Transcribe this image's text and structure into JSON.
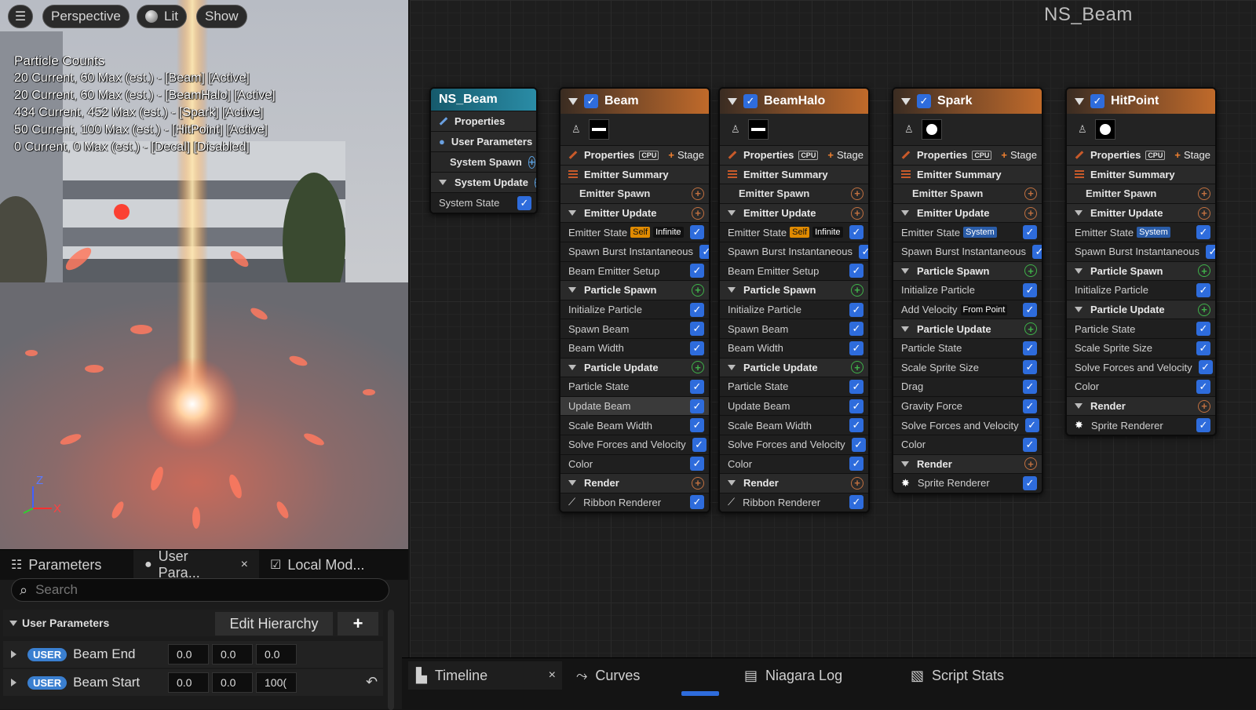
{
  "viewport": {
    "menu_icon": "hamburger-icon",
    "perspective_label": "Perspective",
    "lit_label": "Lit",
    "show_label": "Show",
    "counts_title": "Particle Counts",
    "counts": [
      "20 Current, 60 Max (est.) - [Beam] [Active]",
      "20 Current, 60 Max (est.) - [BeamHalo] [Active]",
      "434 Current, 452 Max (est.) - [Spark] [Active]",
      "50 Current, 100 Max (est.) - [HitPoint] [Active]",
      "0 Current, 0 Max (est.) - [Decal] [Disabled]"
    ],
    "axis_z": "Z",
    "axis_x": "X"
  },
  "graph": {
    "asset_name": "NS_Beam",
    "system_node": {
      "title": "NS_Beam",
      "rows": [
        "Properties",
        "User Parameters",
        "System Spawn",
        "System Update",
        "System State"
      ]
    },
    "emitters": [
      {
        "title": "Beam",
        "props": "Properties",
        "cpu": "CPU",
        "stage": "Stage",
        "summary": "Emitter Summary",
        "rows": [
          {
            "t": "plain",
            "label": "Emitter Spawn",
            "p": "po"
          },
          {
            "t": "head",
            "label": "Emitter Update",
            "p": "po"
          },
          {
            "t": "mod",
            "label": "Emitter State",
            "tags": [
              "Self",
              "Infinite"
            ]
          },
          {
            "t": "mod",
            "label": "Spawn Burst Instantaneous"
          },
          {
            "t": "mod",
            "label": "Beam Emitter Setup"
          },
          {
            "t": "head",
            "label": "Particle Spawn",
            "p": "pg"
          },
          {
            "t": "mod",
            "label": "Initialize Particle"
          },
          {
            "t": "mod",
            "label": "Spawn Beam"
          },
          {
            "t": "mod",
            "label": "Beam Width"
          },
          {
            "t": "head",
            "label": "Particle Update",
            "p": "pg"
          },
          {
            "t": "mod",
            "label": "Particle State"
          },
          {
            "t": "mod",
            "label": "Update Beam",
            "sel": true
          },
          {
            "t": "mod",
            "label": "Scale Beam Width"
          },
          {
            "t": "mod",
            "label": "Solve Forces and Velocity"
          },
          {
            "t": "mod",
            "label": "Color"
          },
          {
            "t": "head",
            "label": "Render",
            "p": "po"
          },
          {
            "t": "mod",
            "label": "Ribbon Renderer",
            "icon": "ribbon"
          }
        ]
      },
      {
        "title": "BeamHalo",
        "props": "Properties",
        "cpu": "CPU",
        "stage": "Stage",
        "summary": "Emitter Summary",
        "rows": [
          {
            "t": "plain",
            "label": "Emitter Spawn",
            "p": "po"
          },
          {
            "t": "head",
            "label": "Emitter Update",
            "p": "po"
          },
          {
            "t": "mod",
            "label": "Emitter State",
            "tags": [
              "Self",
              "Infinite"
            ]
          },
          {
            "t": "mod",
            "label": "Spawn Burst Instantaneous"
          },
          {
            "t": "mod",
            "label": "Beam Emitter Setup"
          },
          {
            "t": "head",
            "label": "Particle Spawn",
            "p": "pg"
          },
          {
            "t": "mod",
            "label": "Initialize Particle"
          },
          {
            "t": "mod",
            "label": "Spawn Beam"
          },
          {
            "t": "mod",
            "label": "Beam Width"
          },
          {
            "t": "head",
            "label": "Particle Update",
            "p": "pg"
          },
          {
            "t": "mod",
            "label": "Particle State"
          },
          {
            "t": "mod",
            "label": "Update Beam"
          },
          {
            "t": "mod",
            "label": "Scale Beam Width"
          },
          {
            "t": "mod",
            "label": "Solve Forces and Velocity"
          },
          {
            "t": "mod",
            "label": "Color"
          },
          {
            "t": "head",
            "label": "Render",
            "p": "po"
          },
          {
            "t": "mod",
            "label": "Ribbon Renderer",
            "icon": "ribbon"
          }
        ]
      },
      {
        "title": "Spark",
        "props": "Properties",
        "cpu": "CPU",
        "stage": "Stage",
        "summary": "Emitter Summary",
        "rows": [
          {
            "t": "plain",
            "label": "Emitter Spawn",
            "p": "po"
          },
          {
            "t": "head",
            "label": "Emitter Update",
            "p": "po"
          },
          {
            "t": "mod",
            "label": "Emitter State",
            "tags": [
              "System"
            ]
          },
          {
            "t": "mod",
            "label": "Spawn Burst Instantaneous"
          },
          {
            "t": "head",
            "label": "Particle Spawn",
            "p": "pg"
          },
          {
            "t": "mod",
            "label": "Initialize Particle"
          },
          {
            "t": "mod",
            "label": "Add Velocity",
            "tags": [
              "From Point"
            ]
          },
          {
            "t": "head",
            "label": "Particle Update",
            "p": "pg"
          },
          {
            "t": "mod",
            "label": "Particle State"
          },
          {
            "t": "mod",
            "label": "Scale Sprite Size"
          },
          {
            "t": "mod",
            "label": "Drag"
          },
          {
            "t": "mod",
            "label": "Gravity Force"
          },
          {
            "t": "mod",
            "label": "Solve Forces and Velocity"
          },
          {
            "t": "mod",
            "label": "Color"
          },
          {
            "t": "head",
            "label": "Render",
            "p": "po"
          },
          {
            "t": "mod",
            "label": "Sprite Renderer",
            "icon": "sprite"
          }
        ]
      },
      {
        "title": "HitPoint",
        "props": "Properties",
        "cpu": "CPU",
        "stage": "Stage",
        "summary": "Emitter Summary",
        "rows": [
          {
            "t": "plain",
            "label": "Emitter Spawn",
            "p": "po"
          },
          {
            "t": "head",
            "label": "Emitter Update",
            "p": "po"
          },
          {
            "t": "mod",
            "label": "Emitter State",
            "tags": [
              "System"
            ]
          },
          {
            "t": "mod",
            "label": "Spawn Burst Instantaneous"
          },
          {
            "t": "head",
            "label": "Particle Spawn",
            "p": "pg"
          },
          {
            "t": "mod",
            "label": "Initialize Particle"
          },
          {
            "t": "head",
            "label": "Particle Update",
            "p": "pg"
          },
          {
            "t": "mod",
            "label": "Particle State"
          },
          {
            "t": "mod",
            "label": "Scale Sprite Size"
          },
          {
            "t": "mod",
            "label": "Solve Forces and Velocity"
          },
          {
            "t": "mod",
            "label": "Color"
          },
          {
            "t": "head",
            "label": "Render",
            "p": "po"
          },
          {
            "t": "mod",
            "label": "Sprite Renderer",
            "icon": "sprite"
          }
        ]
      }
    ]
  },
  "params": {
    "tabs": [
      "Parameters",
      "User Para...",
      "Local Mod..."
    ],
    "search_placeholder": "Search",
    "section": "User Parameters",
    "edit_hierarchy": "Edit Hierarchy",
    "add": "+",
    "rows": [
      {
        "badge": "USER",
        "name": "Beam End",
        "values": [
          "0.0",
          "0.0",
          "0.0"
        ]
      },
      {
        "badge": "USER",
        "name": "Beam Start",
        "values": [
          "0.0",
          "0.0",
          "100("
        ]
      }
    ]
  },
  "bottom_tabs": [
    "Timeline",
    "Curves",
    "Niagara Log",
    "Script Stats"
  ],
  "colors": {
    "accent_blue": "#2e6cdc",
    "emitter_header": "#c06a2a",
    "system_header": "#2a8ca6",
    "user_badge": "#3a7fd0"
  }
}
